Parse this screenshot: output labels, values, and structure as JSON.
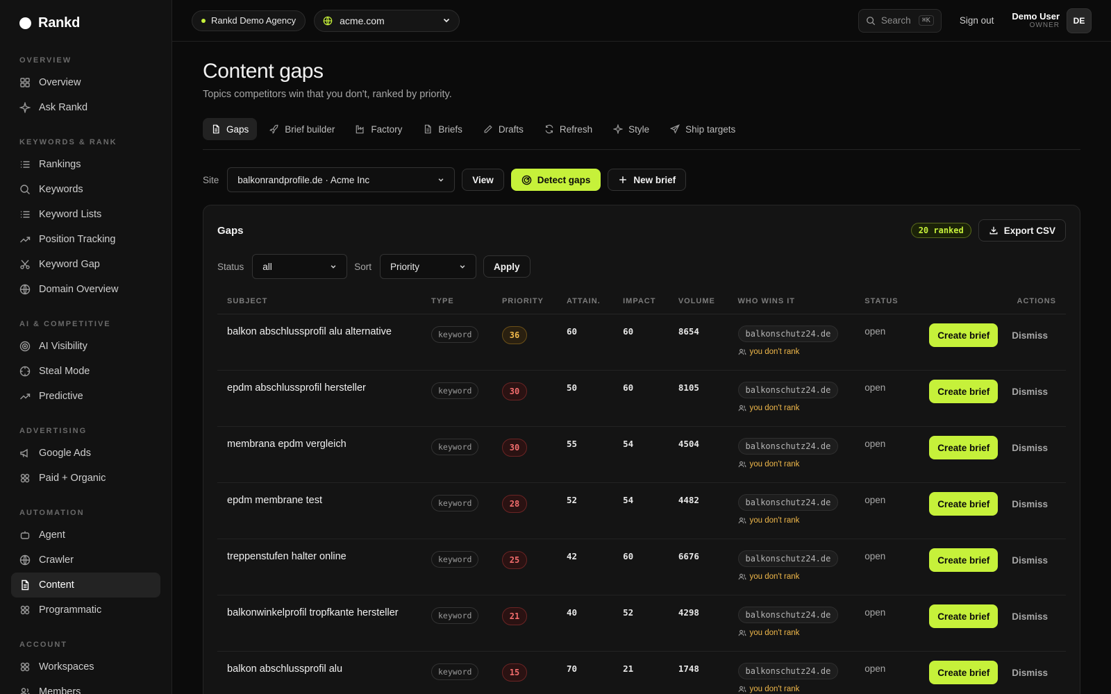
{
  "brand": {
    "name": "Rankd"
  },
  "sidebar": {
    "sections": [
      {
        "title": "OVERVIEW",
        "items": [
          {
            "label": "Overview",
            "icon": "grid-icon"
          },
          {
            "label": "Ask Rankd",
            "icon": "sparkle-icon"
          }
        ]
      },
      {
        "title": "KEYWORDS & RANK",
        "items": [
          {
            "label": "Rankings",
            "icon": "list-icon"
          },
          {
            "label": "Keywords",
            "icon": "search-icon"
          },
          {
            "label": "Keyword Lists",
            "icon": "list-icon"
          },
          {
            "label": "Position Tracking",
            "icon": "trend-icon"
          },
          {
            "label": "Keyword Gap",
            "icon": "scissors-icon"
          },
          {
            "label": "Domain Overview",
            "icon": "globe-icon"
          }
        ]
      },
      {
        "title": "AI & COMPETITIVE",
        "items": [
          {
            "label": "AI Visibility",
            "icon": "target-icon"
          },
          {
            "label": "Steal Mode",
            "icon": "crosshair-icon"
          },
          {
            "label": "Predictive",
            "icon": "trend-icon"
          }
        ]
      },
      {
        "title": "ADVERTISING",
        "items": [
          {
            "label": "Google Ads",
            "icon": "megaphone-icon"
          },
          {
            "label": "Paid + Organic",
            "icon": "layers-icon"
          }
        ]
      },
      {
        "title": "AUTOMATION",
        "items": [
          {
            "label": "Agent",
            "icon": "bot-icon"
          },
          {
            "label": "Crawler",
            "icon": "globe-icon"
          },
          {
            "label": "Content",
            "icon": "file-icon",
            "active": true
          },
          {
            "label": "Programmatic",
            "icon": "layers-icon"
          }
        ]
      },
      {
        "title": "ACCOUNT",
        "items": [
          {
            "label": "Workspaces",
            "icon": "layers-icon"
          },
          {
            "label": "Members",
            "icon": "users-icon"
          }
        ]
      }
    ]
  },
  "topbar": {
    "agency": "Rankd Demo Agency",
    "domain": "acme.com",
    "search_placeholder": "Search",
    "search_kbd": "⌘K",
    "signout": "Sign out",
    "user_name": "Demo User",
    "user_role": "OWNER",
    "avatar_initials": "DE"
  },
  "page": {
    "title": "Content gaps",
    "subtitle": "Topics competitors win that you don't, ranked by priority."
  },
  "tabs": [
    {
      "label": "Gaps",
      "icon": "file-icon",
      "active": true
    },
    {
      "label": "Brief builder",
      "icon": "rocket-icon"
    },
    {
      "label": "Factory",
      "icon": "factory-icon"
    },
    {
      "label": "Briefs",
      "icon": "file-icon"
    },
    {
      "label": "Drafts",
      "icon": "pencil-icon"
    },
    {
      "label": "Refresh",
      "icon": "refresh-icon"
    },
    {
      "label": "Style",
      "icon": "sparkle-icon"
    },
    {
      "label": "Ship targets",
      "icon": "send-icon"
    }
  ],
  "site_row": {
    "site_label": "Site",
    "site_value": "balkonrandprofile.de · Acme Inc",
    "view_label": "View",
    "detect_label": "Detect gaps",
    "new_brief_label": "New brief"
  },
  "card": {
    "title": "Gaps",
    "ranked_badge": "20 ranked",
    "export_label": "Export CSV",
    "status_label": "Status",
    "status_value": "all",
    "sort_label": "Sort",
    "sort_value": "Priority",
    "apply_label": "Apply"
  },
  "table": {
    "headers": [
      "SUBJECT",
      "TYPE",
      "PRIORITY",
      "ATTAIN.",
      "IMPACT",
      "VOLUME",
      "WHO WINS IT",
      "STATUS",
      "ACTIONS"
    ],
    "create_label": "Create brief",
    "dismiss_label": "Dismiss",
    "norank_label": "you don't rank",
    "rows": [
      {
        "subject": "balkon abschlussprofil alu alternative",
        "type": "keyword",
        "priority": "36",
        "prio_level": "amber",
        "attain": "60",
        "impact": "60",
        "volume": "8654",
        "winner": "balkonschutz24.de",
        "status": "open"
      },
      {
        "subject": "epdm abschlussprofil hersteller",
        "type": "keyword",
        "priority": "30",
        "prio_level": "red",
        "attain": "50",
        "impact": "60",
        "volume": "8105",
        "winner": "balkonschutz24.de",
        "status": "open"
      },
      {
        "subject": "membrana epdm vergleich",
        "type": "keyword",
        "priority": "30",
        "prio_level": "red",
        "attain": "55",
        "impact": "54",
        "volume": "4504",
        "winner": "balkonschutz24.de",
        "status": "open"
      },
      {
        "subject": "epdm membrane test",
        "type": "keyword",
        "priority": "28",
        "prio_level": "red",
        "attain": "52",
        "impact": "54",
        "volume": "4482",
        "winner": "balkonschutz24.de",
        "status": "open"
      },
      {
        "subject": "treppenstufen halter online",
        "type": "keyword",
        "priority": "25",
        "prio_level": "red",
        "attain": "42",
        "impact": "60",
        "volume": "6676",
        "winner": "balkonschutz24.de",
        "status": "open"
      },
      {
        "subject": "balkonwinkelprofil tropfkante hersteller",
        "type": "keyword",
        "priority": "21",
        "prio_level": "red",
        "attain": "40",
        "impact": "52",
        "volume": "4298",
        "winner": "balkonschutz24.de",
        "status": "open"
      },
      {
        "subject": "balkon abschlussprofil alu",
        "type": "keyword",
        "priority": "15",
        "prio_level": "red",
        "attain": "70",
        "impact": "21",
        "volume": "1748",
        "winner": "balkonschutz24.de",
        "status": "open"
      }
    ]
  }
}
